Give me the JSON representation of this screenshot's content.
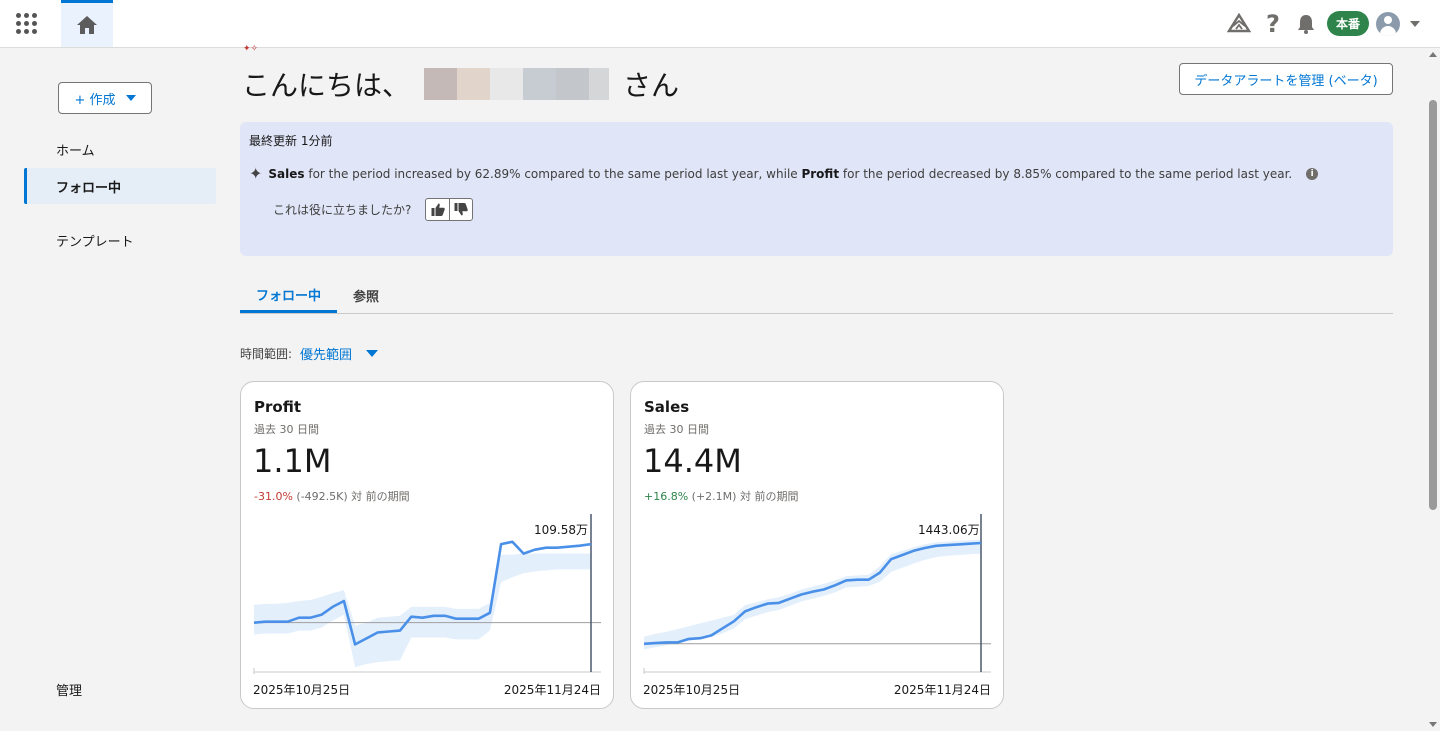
{
  "topbar": {
    "home_tab": "home-icon",
    "env_badge": "本番",
    "icons": [
      "waffle-icon",
      "trailhead-icon",
      "help-icon",
      "bell-icon",
      "avatar-icon",
      "chevron-down-icon"
    ]
  },
  "sidebar": {
    "create_label": "+ 作成",
    "items": [
      {
        "label": "ホーム"
      },
      {
        "label": "フォロー中"
      },
      {
        "label": "テンプレート"
      },
      {
        "label": "管理"
      }
    ]
  },
  "header": {
    "greeting_prefix": "こんにちは、",
    "greeting_suffix": "さん",
    "manage_button": "データアラートを管理 (ベータ)"
  },
  "insight": {
    "updated": "最終更新 1分前",
    "metric1": "Sales",
    "text1": " for the period increased by 62.89% compared to the same period last year, while ",
    "metric2": "Profit",
    "text2": " for the period decreased by 8.85% compared to the same period last year.",
    "helpful": "これは役に立ちましたか?"
  },
  "tabs": [
    "フォロー中",
    "参照"
  ],
  "timerange": {
    "label": "時間範囲:",
    "value": "優先範囲"
  },
  "colors": {
    "accent": "#0176d3",
    "line": "#4a90e8",
    "band": "#e4effc",
    "negative": "#c23934",
    "positive": "#2e844a"
  },
  "cards": [
    {
      "name": "Profit",
      "period": "過去 30 日間",
      "value": "1.1M",
      "change": "-31.0%",
      "change_detail": " (-492.5K) 対 前の期間",
      "x_start": "2025年10月25日",
      "x_end": "2025年11月24日",
      "peak_label": "109.58万"
    },
    {
      "name": "Sales",
      "period": "過去 30 日間",
      "value": "14.4M",
      "change": "+16.8%",
      "change_detail": " (+2.1M) 対 前の期間",
      "x_start": "2025年10月25日",
      "x_end": "2025年11月24日",
      "peak_label": "1443.06万"
    }
  ],
  "chart_data": [
    {
      "type": "line",
      "title": "Profit",
      "x": [
        "2025年10月25日",
        "",
        "",
        "",
        "",
        "",
        "",
        "",
        "",
        "",
        "",
        "",
        "",
        "",
        "",
        "",
        "",
        "",
        "",
        "",
        "",
        "",
        "",
        "",
        "",
        "",
        "",
        "",
        "",
        "",
        "2025年11月24日"
      ],
      "series": [
        {
          "values": [
            30,
            31,
            31,
            31,
            35,
            35,
            38,
            46,
            52,
            8,
            14,
            20,
            21,
            22,
            36,
            35,
            37,
            37,
            34,
            34,
            34,
            40,
            109.58,
            112,
            100,
            104,
            106,
            106,
            107,
            108,
            109.58
          ]
        }
      ],
      "band_upper": [
        48,
        49,
        49,
        50,
        52,
        53,
        56,
        60,
        63,
        27,
        30,
        35,
        36,
        37,
        46,
        46,
        46,
        46,
        44,
        44,
        44,
        50,
        99,
        99,
        100,
        100,
        100,
        100,
        100,
        100,
        100
      ],
      "band_lower": [
        18,
        19,
        19,
        19,
        22,
        22,
        25,
        32,
        38,
        -15,
        -12,
        -10,
        -9,
        -8,
        15,
        15,
        15,
        15,
        13,
        13,
        13,
        22,
        71,
        76,
        80,
        82,
        83,
        84,
        84,
        84,
        84
      ],
      "ylim": [
        -20,
        130
      ]
    },
    {
      "type": "line",
      "title": "Sales",
      "x": [
        "2025年10月25日",
        "",
        "",
        "",
        "",
        "",
        "",
        "",
        "",
        "",
        "",
        "",
        "",
        "",
        "",
        "",
        "",
        "",
        "",
        "",
        "",
        "",
        "",
        "",
        "",
        "",
        "",
        "",
        "",
        "",
        "2025年11月24日"
      ],
      "series": [
        {
          "values": [
            40,
            41,
            42,
            42,
            47,
            48,
            52,
            62,
            72,
            86,
            92,
            97,
            98,
            104,
            110,
            114,
            117,
            123,
            130,
            131,
            131,
            141,
            160,
            166,
            172,
            176,
            179,
            180,
            181,
            182,
            183
          ]
        }
      ],
      "band_upper": [
        50,
        54,
        57,
        61,
        65,
        69,
        73,
        77,
        81,
        95,
        99,
        103,
        106,
        111,
        117,
        121,
        125,
        130,
        136,
        137,
        138,
        150,
        167,
        172,
        177,
        181,
        184,
        185,
        186,
        187,
        188
      ],
      "band_lower": [
        32,
        35,
        38,
        41,
        44,
        47,
        50,
        55,
        62,
        75,
        80,
        85,
        88,
        94,
        100,
        104,
        108,
        113,
        120,
        121,
        122,
        128,
        142,
        148,
        154,
        159,
        163,
        165,
        166,
        167,
        168
      ],
      "ylim": [
        0,
        210
      ]
    }
  ]
}
